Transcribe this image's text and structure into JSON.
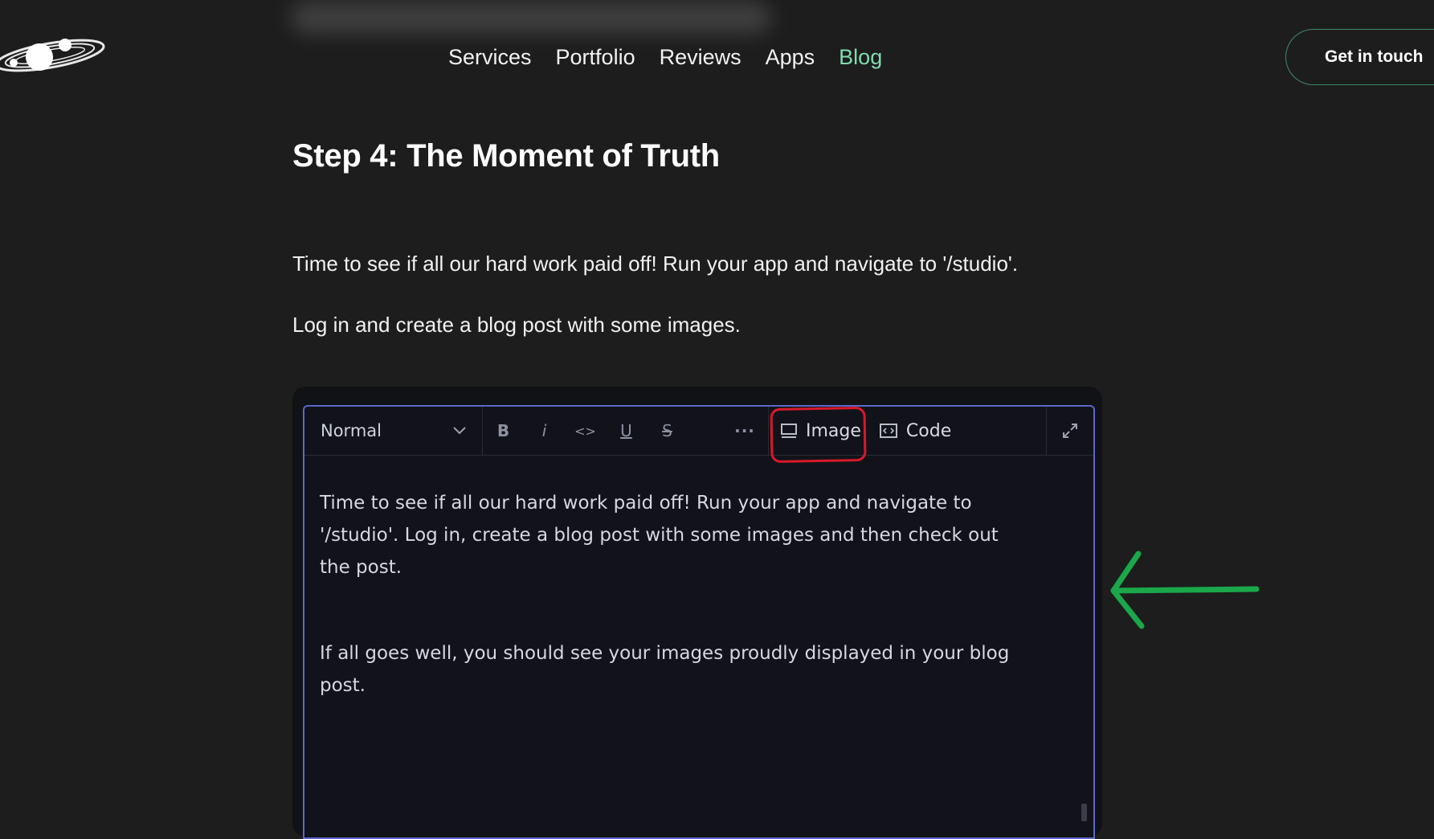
{
  "nav": {
    "items": [
      {
        "label": "Services"
      },
      {
        "label": "Portfolio"
      },
      {
        "label": "Reviews"
      },
      {
        "label": "Apps"
      },
      {
        "label": "Blog",
        "active": true
      }
    ],
    "cta_label": "Get in touch"
  },
  "article": {
    "heading": "Step 4: The Moment of Truth",
    "paragraphs": [
      "Time to see if all our hard work paid off! Run your app and navigate to '/studio'.",
      "Log in and create a blog post with some images."
    ]
  },
  "screenshot": {
    "toolbar": {
      "block_style": "Normal",
      "bold": "B",
      "italic": "i",
      "code_inline": "<>",
      "underline": "U",
      "strike": "S",
      "more": "···",
      "image_label": "Image",
      "code_label": "Code"
    },
    "content": [
      "Time to see if all our hard work paid off! Run your app and navigate to '/studio'. Log in, create a blog post with some images and then check out the post.",
      "If all goes well, you should see your images proudly displayed in your blog post."
    ]
  },
  "colors": {
    "background": "#1d1d1d",
    "accent": "#7fdcae",
    "editor_border": "#5c68c8",
    "annotation_red": "#d8192a",
    "annotation_green": "#1aa84a"
  }
}
